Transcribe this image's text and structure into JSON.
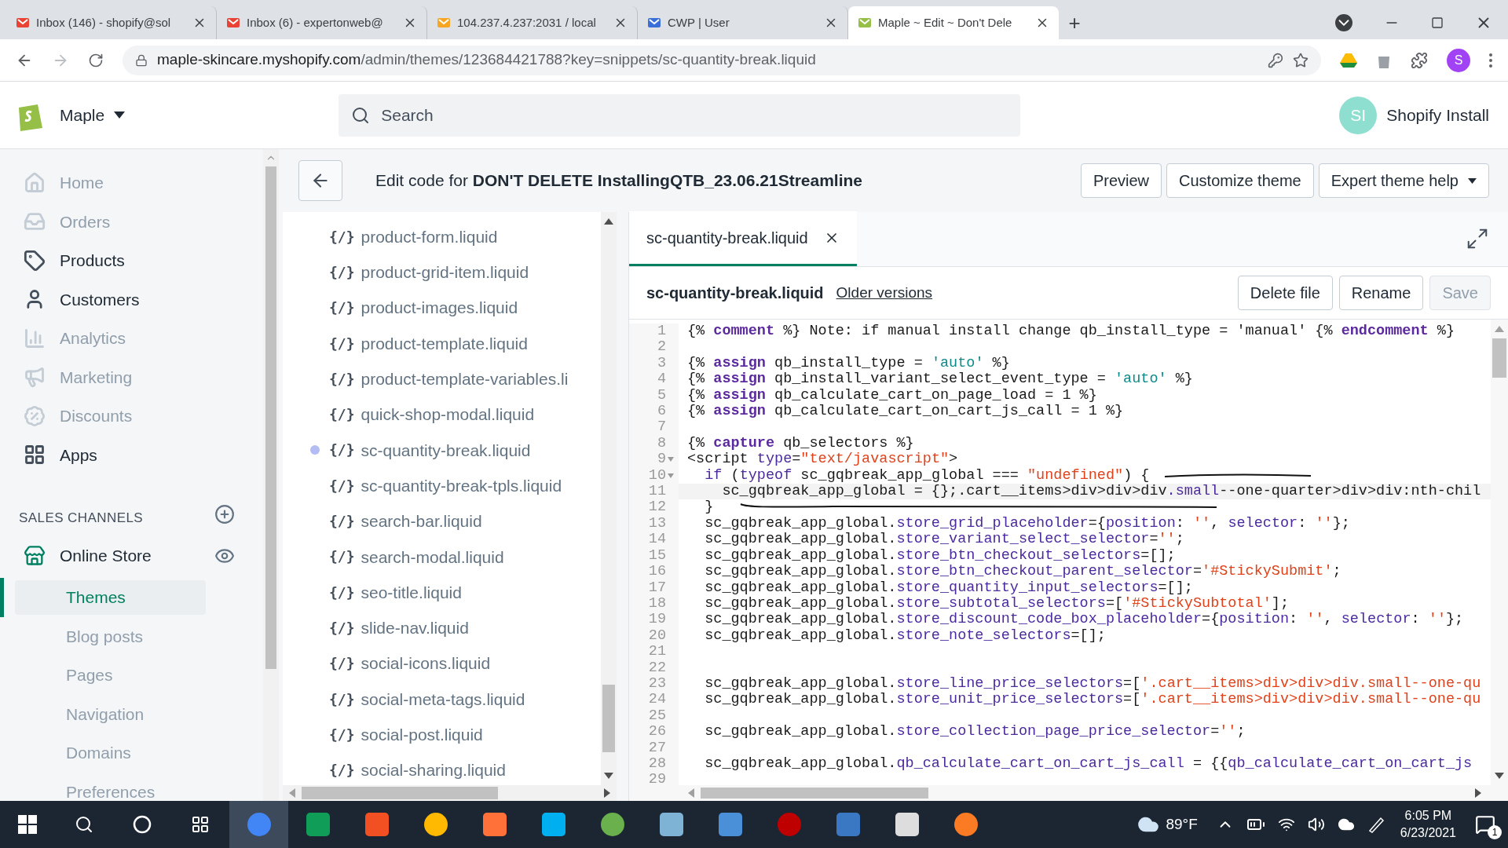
{
  "browser": {
    "tabs": [
      {
        "title": "Inbox (146) - shopify@sol",
        "selected": false
      },
      {
        "title": "Inbox (6) - expertonweb@",
        "selected": false
      },
      {
        "title": "104.237.4.237:2031 / local",
        "selected": false
      },
      {
        "title": "CWP | User",
        "selected": false
      },
      {
        "title": "Maple ~ Edit ~ Don't Dele",
        "selected": true
      }
    ],
    "new_tab": "+",
    "url_host": "maple-skincare.myshopify.com",
    "url_path": "/admin/themes/123684421788?key=snippets/sc-quantity-break.liquid",
    "profile": "S"
  },
  "topbar": {
    "store": "Maple",
    "search": {
      "placeholder": "Search"
    },
    "avatar": "SI",
    "user": "Shopify Install"
  },
  "nav": {
    "items": [
      {
        "label": "Home",
        "disabled": true
      },
      {
        "label": "Orders",
        "disabled": true
      },
      {
        "label": "Products",
        "disabled": false
      },
      {
        "label": "Customers",
        "disabled": false
      },
      {
        "label": "Analytics",
        "disabled": true
      },
      {
        "label": "Marketing",
        "disabled": true
      },
      {
        "label": "Discounts",
        "disabled": true
      },
      {
        "label": "Apps",
        "disabled": false
      }
    ],
    "sales_heading": "SALES CHANNELS",
    "channel": "Online Store",
    "subitems": [
      {
        "label": "Themes",
        "selected": true
      },
      {
        "label": "Blog posts",
        "selected": false
      },
      {
        "label": "Pages",
        "selected": false
      },
      {
        "label": "Navigation",
        "selected": false
      },
      {
        "label": "Domains",
        "selected": false
      },
      {
        "label": "Preferences",
        "selected": false
      }
    ]
  },
  "header": {
    "title": "Edit code for **DON'T DELETE InstallingQTB_23.06.21Streamline**",
    "buttons": [
      {
        "label": "Preview",
        "menu": false
      },
      {
        "label": "Customize theme",
        "menu": false
      },
      {
        "label": "Expert theme help",
        "menu": true
      }
    ]
  },
  "files": [
    {
      "icon": "{/}",
      "name": "product-form.liquid",
      "selected": false
    },
    {
      "icon": "{/}",
      "name": "product-grid-item.liquid",
      "selected": false
    },
    {
      "icon": "{/}",
      "name": "product-images.liquid",
      "selected": false
    },
    {
      "icon": "{/}",
      "name": "product-template.liquid",
      "selected": false
    },
    {
      "icon": "{/}",
      "name": "product-template-variables.li",
      "selected": false
    },
    {
      "icon": "{/}",
      "name": "quick-shop-modal.liquid",
      "selected": false
    },
    {
      "icon": "{/}",
      "name": "sc-quantity-break.liquid",
      "selected": true
    },
    {
      "icon": "{/}",
      "name": "sc-quantity-break-tpls.liquid",
      "selected": false
    },
    {
      "icon": "{/}",
      "name": "search-bar.liquid",
      "selected": false
    },
    {
      "icon": "{/}",
      "name": "search-modal.liquid",
      "selected": false
    },
    {
      "icon": "{/}",
      "name": "seo-title.liquid",
      "selected": false
    },
    {
      "icon": "{/}",
      "name": "slide-nav.liquid",
      "selected": false
    },
    {
      "icon": "{/}",
      "name": "social-icons.liquid",
      "selected": false
    },
    {
      "icon": "{/}",
      "name": "social-meta-tags.liquid",
      "selected": false
    },
    {
      "icon": "{/}",
      "name": "social-post.liquid",
      "selected": false
    },
    {
      "icon": "{/}",
      "name": "social-sharing.liquid",
      "selected": false
    }
  ],
  "editor": {
    "tabs": [
      {
        "label": "sc-quantity-break.liquid",
        "selected": true
      }
    ],
    "file_title": "sc-quantity-break.liquid",
    "older_versions": "Older versions",
    "actions": [
      {
        "label": "Delete file",
        "disabled": false
      },
      {
        "label": "Rename",
        "disabled": false
      },
      {
        "label": "Save",
        "disabled": true
      }
    ],
    "lines": [
      {
        "number": "1",
        "tokens": [
          {
            "kind": "t",
            "text": "{% "
          },
          {
            "kind": "k",
            "text": "comment"
          },
          {
            "kind": "t",
            "text": " %} Note: if manual install change qb_install_type = 'manual' {% "
          },
          {
            "kind": "k",
            "text": "endcomment"
          },
          {
            "kind": "t",
            "text": " %}"
          }
        ]
      },
      {
        "number": "2"
      },
      {
        "number": "3",
        "tokens": [
          {
            "kind": "t",
            "text": "{% "
          },
          {
            "kind": "k",
            "text": "assign"
          },
          {
            "kind": "t",
            "text": " qb_install_type = "
          },
          {
            "kind": "v",
            "text": "'auto'"
          },
          {
            "kind": "t",
            "text": " %}"
          }
        ]
      },
      {
        "number": "4",
        "tokens": [
          {
            "kind": "t",
            "text": "{% "
          },
          {
            "kind": "k",
            "text": "assign"
          },
          {
            "kind": "t",
            "text": " qb_install_variant_select_event_type = "
          },
          {
            "kind": "v",
            "text": "'auto'"
          },
          {
            "kind": "t",
            "text": " %}"
          }
        ]
      },
      {
        "number": "5",
        "tokens": [
          {
            "kind": "t",
            "text": "{% "
          },
          {
            "kind": "k",
            "text": "assign"
          },
          {
            "kind": "t",
            "text": " qb_calculate_cart_on_page_load = 1 %}"
          }
        ]
      },
      {
        "number": "6",
        "tokens": [
          {
            "kind": "t",
            "text": "{% "
          },
          {
            "kind": "k",
            "text": "assign"
          },
          {
            "kind": "t",
            "text": " qb_calculate_cart_on_cart_js_call = 1 %}"
          }
        ]
      },
      {
        "number": "7"
      },
      {
        "number": "8",
        "tokens": [
          {
            "kind": "t",
            "text": "{% "
          },
          {
            "kind": "k",
            "text": "capture"
          },
          {
            "kind": "t",
            "text": " qb_selectors %}"
          }
        ]
      },
      {
        "number": "9",
        "fold": true,
        "tokens": [
          {
            "kind": "t",
            "text": "<script "
          },
          {
            "kind": "p",
            "text": "type"
          },
          {
            "kind": "t",
            "text": "="
          },
          {
            "kind": "s",
            "text": "\"text/javascript\""
          },
          {
            "kind": "t",
            "text": ">"
          }
        ]
      },
      {
        "number": "10",
        "fold": true,
        "tokens": [
          {
            "kind": "p",
            "text": "  if"
          },
          {
            "kind": "t",
            "text": " ("
          },
          {
            "kind": "p",
            "text": "typeof"
          },
          {
            "kind": "t",
            "text": " sc_gqbreak_app_global === "
          },
          {
            "kind": "s",
            "text": "\"undefined\""
          },
          {
            "kind": "t",
            "text": ") {"
          }
        ]
      },
      {
        "number": "11",
        "current": true,
        "tokens": [
          {
            "kind": "t",
            "text": "    sc_gqbreak_app_global = {};.cart__items>div>div>div"
          },
          {
            "kind": "p",
            "text": ".small"
          },
          {
            "kind": "t",
            "text": "--one-quarter>div>div:nth-chil"
          }
        ]
      },
      {
        "number": "12",
        "tokens": [
          {
            "kind": "t",
            "text": "  }"
          }
        ]
      },
      {
        "number": "13",
        "tokens": [
          {
            "kind": "t",
            "text": "  sc_gqbreak_app_global."
          },
          {
            "kind": "p",
            "text": "store_grid_placeholder"
          },
          {
            "kind": "t",
            "text": "={"
          },
          {
            "kind": "p",
            "text": "position"
          },
          {
            "kind": "t",
            "text": ": "
          },
          {
            "kind": "s",
            "text": "''"
          },
          {
            "kind": "t",
            "text": ", "
          },
          {
            "kind": "p",
            "text": "selector"
          },
          {
            "kind": "t",
            "text": ": "
          },
          {
            "kind": "s",
            "text": "''"
          },
          {
            "kind": "t",
            "text": "};"
          }
        ]
      },
      {
        "number": "14",
        "tokens": [
          {
            "kind": "t",
            "text": "  sc_gqbreak_app_global."
          },
          {
            "kind": "p",
            "text": "store_variant_select_selector"
          },
          {
            "kind": "t",
            "text": "="
          },
          {
            "kind": "s",
            "text": "''"
          },
          {
            "kind": "t",
            "text": ";"
          }
        ]
      },
      {
        "number": "15",
        "tokens": [
          {
            "kind": "t",
            "text": "  sc_gqbreak_app_global."
          },
          {
            "kind": "p",
            "text": "store_btn_checkout_selectors"
          },
          {
            "kind": "t",
            "text": "=[];"
          }
        ]
      },
      {
        "number": "16",
        "tokens": [
          {
            "kind": "t",
            "text": "  sc_gqbreak_app_global."
          },
          {
            "kind": "p",
            "text": "store_btn_checkout_parent_selector"
          },
          {
            "kind": "t",
            "text": "="
          },
          {
            "kind": "s",
            "text": "'#StickySubmit'"
          },
          {
            "kind": "t",
            "text": ";"
          }
        ]
      },
      {
        "number": "17",
        "tokens": [
          {
            "kind": "t",
            "text": "  sc_gqbreak_app_global."
          },
          {
            "kind": "p",
            "text": "store_quantity_input_selectors"
          },
          {
            "kind": "t",
            "text": "=[];"
          }
        ]
      },
      {
        "number": "18",
        "tokens": [
          {
            "kind": "t",
            "text": "  sc_gqbreak_app_global."
          },
          {
            "kind": "p",
            "text": "store_subtotal_selectors"
          },
          {
            "kind": "t",
            "text": "=["
          },
          {
            "kind": "s",
            "text": "'#StickySubtotal'"
          },
          {
            "kind": "t",
            "text": "];"
          }
        ]
      },
      {
        "number": "19",
        "tokens": [
          {
            "kind": "t",
            "text": "  sc_gqbreak_app_global."
          },
          {
            "kind": "p",
            "text": "store_discount_code_box_placeholder"
          },
          {
            "kind": "t",
            "text": "={"
          },
          {
            "kind": "p",
            "text": "position"
          },
          {
            "kind": "t",
            "text": ": "
          },
          {
            "kind": "s",
            "text": "''"
          },
          {
            "kind": "t",
            "text": ", "
          },
          {
            "kind": "p",
            "text": "selector"
          },
          {
            "kind": "t",
            "text": ": "
          },
          {
            "kind": "s",
            "text": "''"
          },
          {
            "kind": "t",
            "text": "};"
          }
        ]
      },
      {
        "number": "20",
        "tokens": [
          {
            "kind": "t",
            "text": "  sc_gqbreak_app_global."
          },
          {
            "kind": "p",
            "text": "store_note_selectors"
          },
          {
            "kind": "t",
            "text": "=[];"
          }
        ]
      },
      {
        "number": "21"
      },
      {
        "number": "22"
      },
      {
        "number": "23",
        "tokens": [
          {
            "kind": "t",
            "text": "  sc_gqbreak_app_global."
          },
          {
            "kind": "p",
            "text": "store_line_price_selectors"
          },
          {
            "kind": "t",
            "text": "=["
          },
          {
            "kind": "s",
            "text": "'.cart__items>div>div>div.small--one-qu"
          }
        ]
      },
      {
        "number": "24",
        "tokens": [
          {
            "kind": "t",
            "text": "  sc_gqbreak_app_global."
          },
          {
            "kind": "p",
            "text": "store_unit_price_selectors"
          },
          {
            "kind": "t",
            "text": "=["
          },
          {
            "kind": "s",
            "text": "'.cart__items>div>div>div.small--one-qu"
          }
        ]
      },
      {
        "number": "25"
      },
      {
        "number": "26",
        "tokens": [
          {
            "kind": "t",
            "text": "  sc_gqbreak_app_global."
          },
          {
            "kind": "p",
            "text": "store_collection_page_price_selector"
          },
          {
            "kind": "t",
            "text": "="
          },
          {
            "kind": "s",
            "text": "''"
          },
          {
            "kind": "t",
            "text": ";"
          }
        ]
      },
      {
        "number": "27"
      },
      {
        "number": "28",
        "tokens": [
          {
            "kind": "t",
            "text": "  sc_gqbreak_app_global."
          },
          {
            "kind": "p",
            "text": "qb_calculate_cart_on_cart_js_call"
          },
          {
            "kind": "t",
            "text": " = {{"
          },
          {
            "kind": "p",
            "text": "qb_calculate_cart_on_cart_js"
          }
        ]
      },
      {
        "number": "29"
      }
    ]
  },
  "taskbar": {
    "weather": "89°F",
    "time": "6:05 PM",
    "date": "6/23/2021",
    "notifications": "1"
  }
}
